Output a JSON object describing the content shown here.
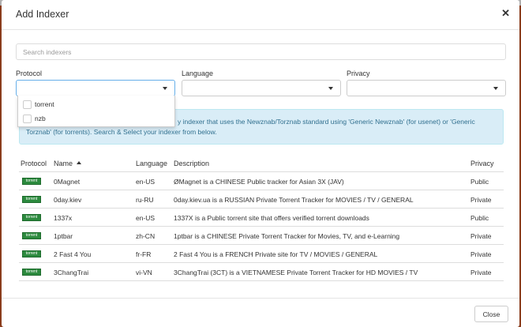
{
  "modal": {
    "title": "Add Indexer",
    "close_label": "Close"
  },
  "search": {
    "placeholder": "Search indexers"
  },
  "filters": {
    "protocol_label": "Protocol",
    "language_label": "Language",
    "privacy_label": "Privacy",
    "protocol_options": [
      "torrent",
      "nzb"
    ]
  },
  "alert": {
    "text_line1": "y indexer that uses the Newznab/Torznab standard using 'Generic Newznab' (for usenet) or 'Generic",
    "text_line2": "Torznab' (for torrents). Search & Select your indexer from below."
  },
  "table": {
    "headers": {
      "protocol": "Protocol",
      "name": "Name",
      "language": "Language",
      "description": "Description",
      "privacy": "Privacy"
    },
    "rows": [
      {
        "protocol": "torrent",
        "name": "0Magnet",
        "language": "en-US",
        "description": "ØMagnet is a CHINESE Public tracker for Asian 3X (JAV)",
        "privacy": "Public"
      },
      {
        "protocol": "torrent",
        "name": "0day.kiev",
        "language": "ru-RU",
        "description": "0day.kiev.ua is a RUSSIAN Private Torrent Tracker for MOVIES / TV / GENERAL",
        "privacy": "Private"
      },
      {
        "protocol": "torrent",
        "name": "1337x",
        "language": "en-US",
        "description": "1337X is a Public torrent site that offers verified torrent downloads",
        "privacy": "Public"
      },
      {
        "protocol": "torrent",
        "name": "1ptbar",
        "language": "zh-CN",
        "description": "1ptbar is a CHINESE Private Torrent Tracker for Movies, TV, and e-Learning",
        "privacy": "Private"
      },
      {
        "protocol": "torrent",
        "name": "2 Fast 4 You",
        "language": "fr-FR",
        "description": "2 Fast 4 You is a FRENCH Private site for TV / MOVIES / GENERAL",
        "privacy": "Private"
      },
      {
        "protocol": "torrent",
        "name": "3ChangTrai",
        "language": "vi-VN",
        "description": "3ChangTrai (3CT) is a VIETNAMESE Private Torrent Tracker for HD MOVIES / TV",
        "privacy": "Private"
      }
    ]
  },
  "colors": {
    "badge": "#2c8a3e",
    "alert_bg": "#d9edf7",
    "alert_text": "#31708f",
    "focus_border": "#66afe9"
  },
  "icons": {
    "close": "close-icon",
    "sort": "sort-ascending-icon",
    "caret": "chevron-down-icon"
  }
}
